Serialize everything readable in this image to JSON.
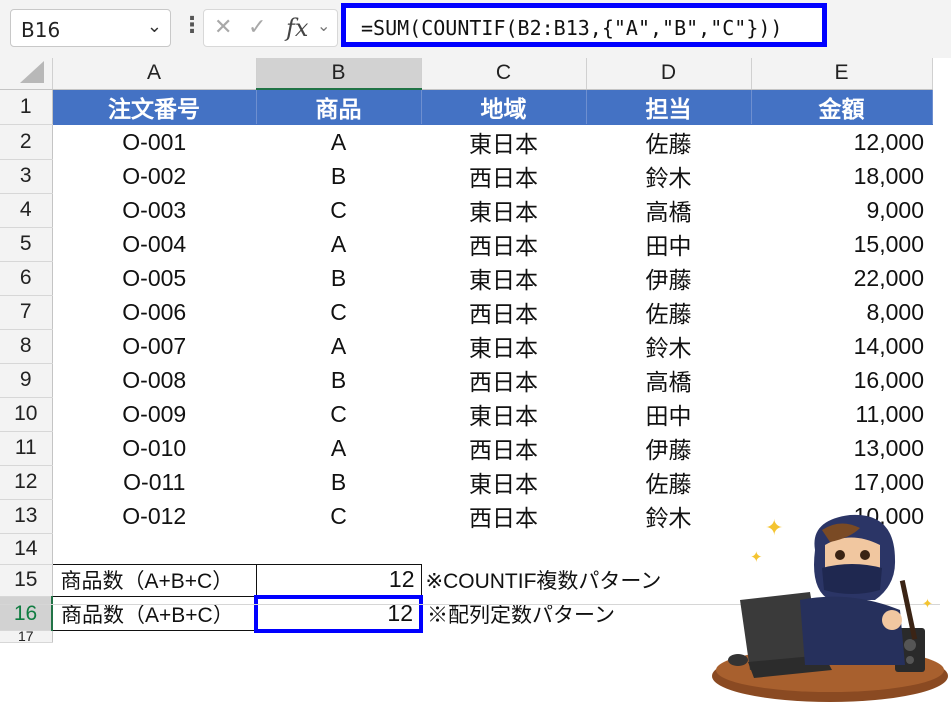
{
  "namebox": {
    "value": "B16"
  },
  "formula_bar": {
    "fx_label": "fx",
    "formula": "=SUM(COUNTIF(B2:B13,{\"A\",\"B\",\"C\"}))"
  },
  "columns": [
    "A",
    "B",
    "C",
    "D",
    "E"
  ],
  "selected_column": "B",
  "selected_row": "16",
  "header_row": {
    "row": "1",
    "cells": [
      "注文番号",
      "商品",
      "地域",
      "担当",
      "金額"
    ]
  },
  "rows": [
    {
      "row": "2",
      "cells": [
        "O-001",
        "A",
        "東日本",
        "佐藤",
        "12,000"
      ]
    },
    {
      "row": "3",
      "cells": [
        "O-002",
        "B",
        "西日本",
        "鈴木",
        "18,000"
      ]
    },
    {
      "row": "4",
      "cells": [
        "O-003",
        "C",
        "東日本",
        "高橋",
        "9,000"
      ]
    },
    {
      "row": "5",
      "cells": [
        "O-004",
        "A",
        "西日本",
        "田中",
        "15,000"
      ]
    },
    {
      "row": "6",
      "cells": [
        "O-005",
        "B",
        "東日本",
        "伊藤",
        "22,000"
      ]
    },
    {
      "row": "7",
      "cells": [
        "O-006",
        "C",
        "西日本",
        "佐藤",
        "8,000"
      ]
    },
    {
      "row": "8",
      "cells": [
        "O-007",
        "A",
        "東日本",
        "鈴木",
        "14,000"
      ]
    },
    {
      "row": "9",
      "cells": [
        "O-008",
        "B",
        "西日本",
        "高橋",
        "16,000"
      ]
    },
    {
      "row": "10",
      "cells": [
        "O-009",
        "C",
        "東日本",
        "田中",
        "11,000"
      ]
    },
    {
      "row": "11",
      "cells": [
        "O-010",
        "A",
        "西日本",
        "伊藤",
        "13,000"
      ]
    },
    {
      "row": "12",
      "cells": [
        "O-011",
        "B",
        "東日本",
        "佐藤",
        "17,000"
      ]
    },
    {
      "row": "13",
      "cells": [
        "O-012",
        "C",
        "西日本",
        "鈴木",
        "10,000"
      ]
    }
  ],
  "empty_row": "14",
  "summary_rows": [
    {
      "row": "15",
      "label": "商品数（A+B+C）",
      "value": "12",
      "note": "※COUNTIF複数パターン"
    },
    {
      "row": "16",
      "label": "商品数（A+B+C）",
      "value": "12",
      "note": "※配列定数パターン"
    }
  ],
  "partial_row": "17",
  "colors": {
    "header_fill": "#4472c4",
    "highlight_border": "#0000ff",
    "selection_green": "#217346"
  },
  "icons": {
    "namebox_dropdown": "chevron-down-icon",
    "options": "kebab-icon",
    "cancel": "cancel-x-icon",
    "enter": "check-icon",
    "function": "fx-icon",
    "corner": "select-all-icon"
  }
}
